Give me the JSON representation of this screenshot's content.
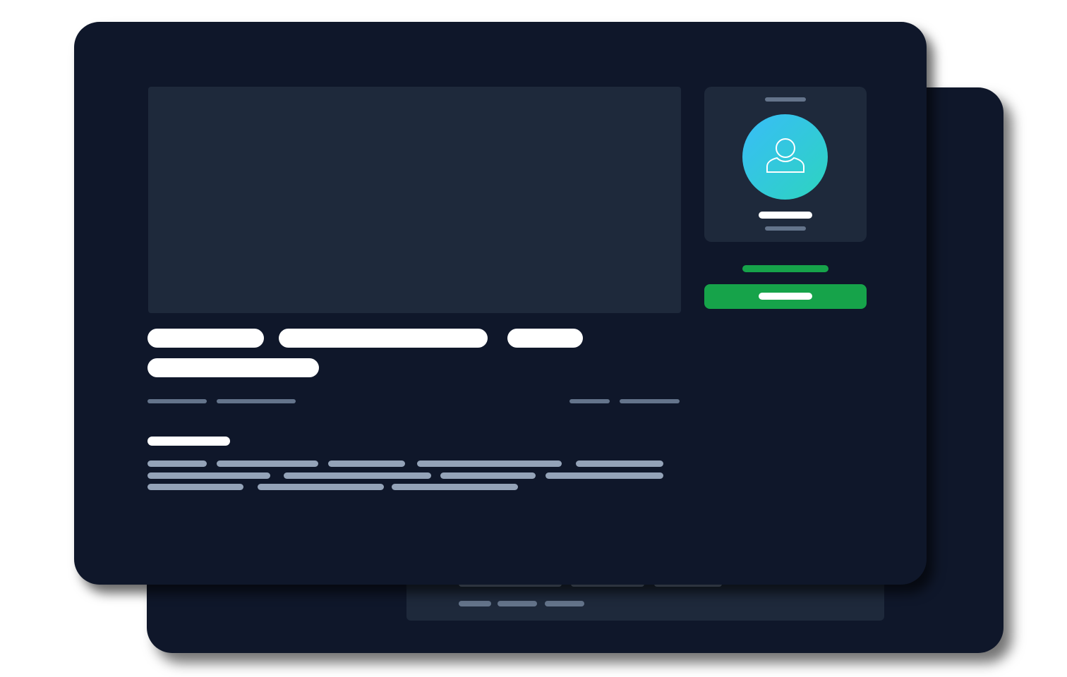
{
  "theme": {
    "card_bg": "#0f172a",
    "panel_bg": "#1e293b",
    "accent_green": "#16a34a",
    "avatar_gradient": [
      "#38bdf8",
      "#2dd4bf"
    ],
    "text_placeholder_gray": "#94a3b8"
  },
  "profile": {
    "avatar_icon": "user-icon"
  },
  "icons": [
    "user-icon"
  ]
}
